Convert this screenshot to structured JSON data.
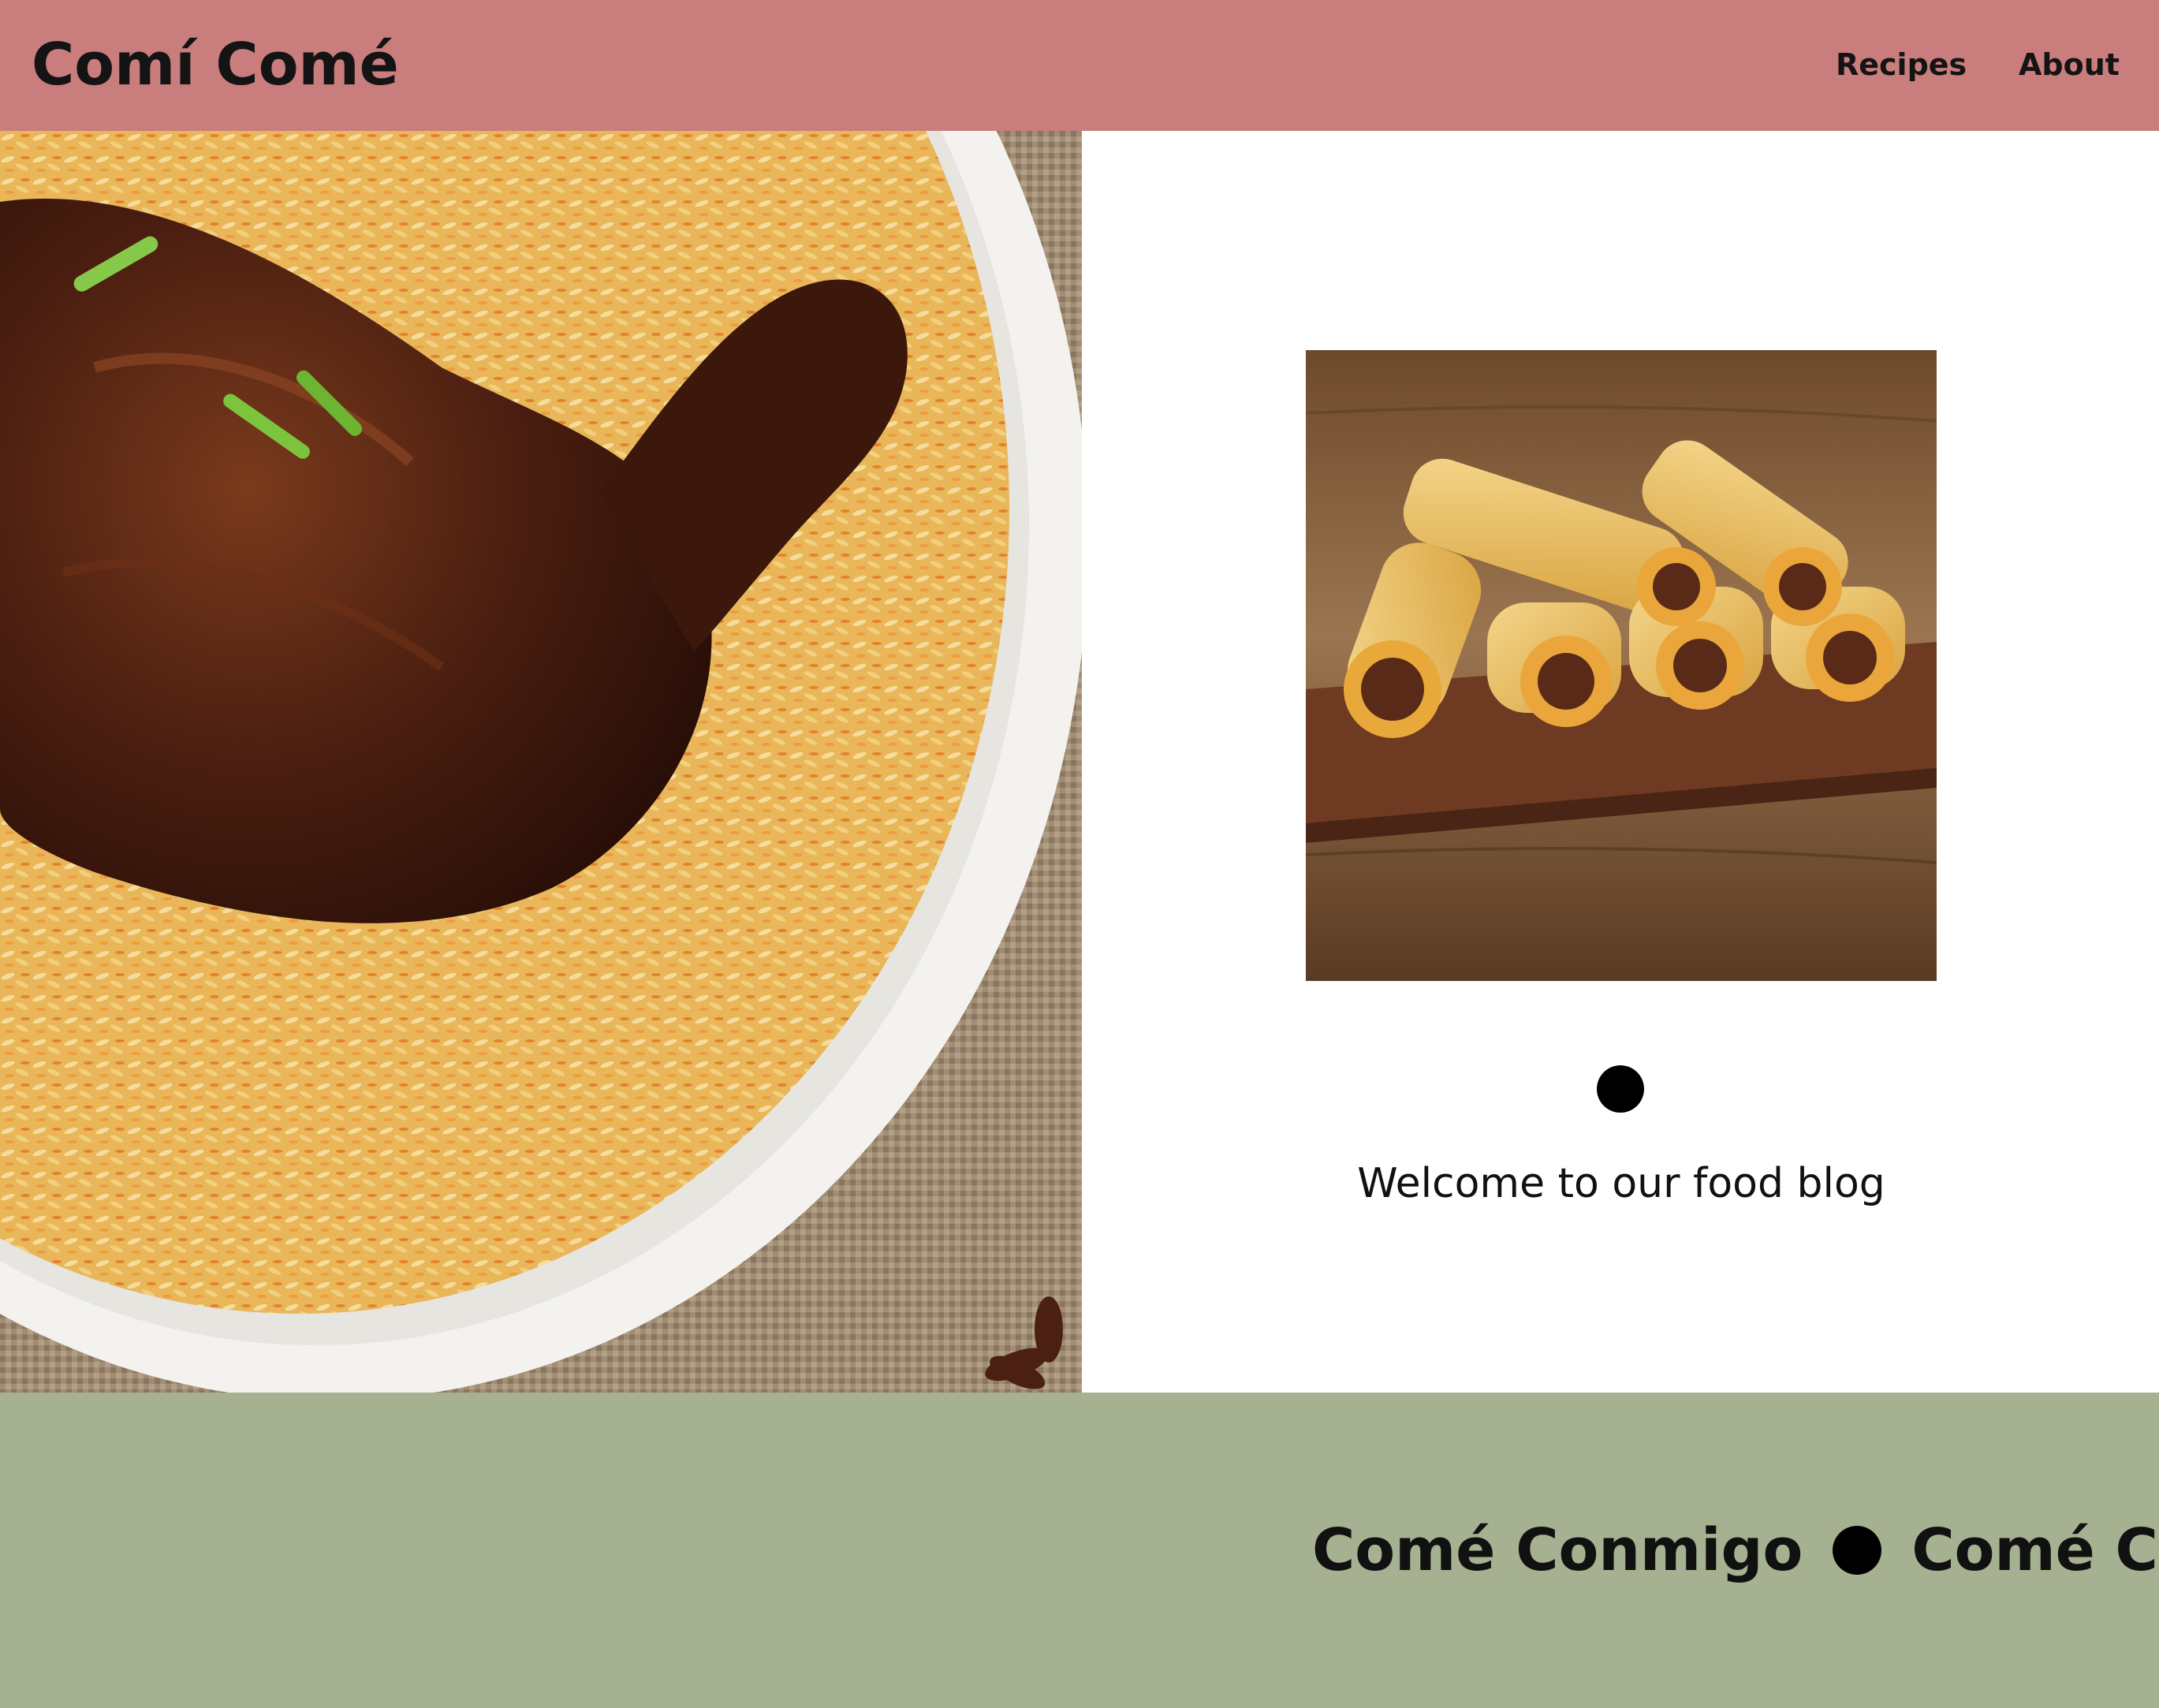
{
  "header": {
    "brand": "Comí Comé",
    "nav": [
      {
        "label": "Recipes"
      },
      {
        "label": "About"
      }
    ],
    "background_color": "#c97d7c"
  },
  "hero": {
    "image": "chicken-and-rice-photo"
  },
  "feature": {
    "image": "tamales-photo",
    "welcome_text": "Welcome to our food blog"
  },
  "marquee": {
    "items": [
      "Comé Conmigo",
      "Comé Conmigo"
    ],
    "background_color": "#a5b190"
  }
}
